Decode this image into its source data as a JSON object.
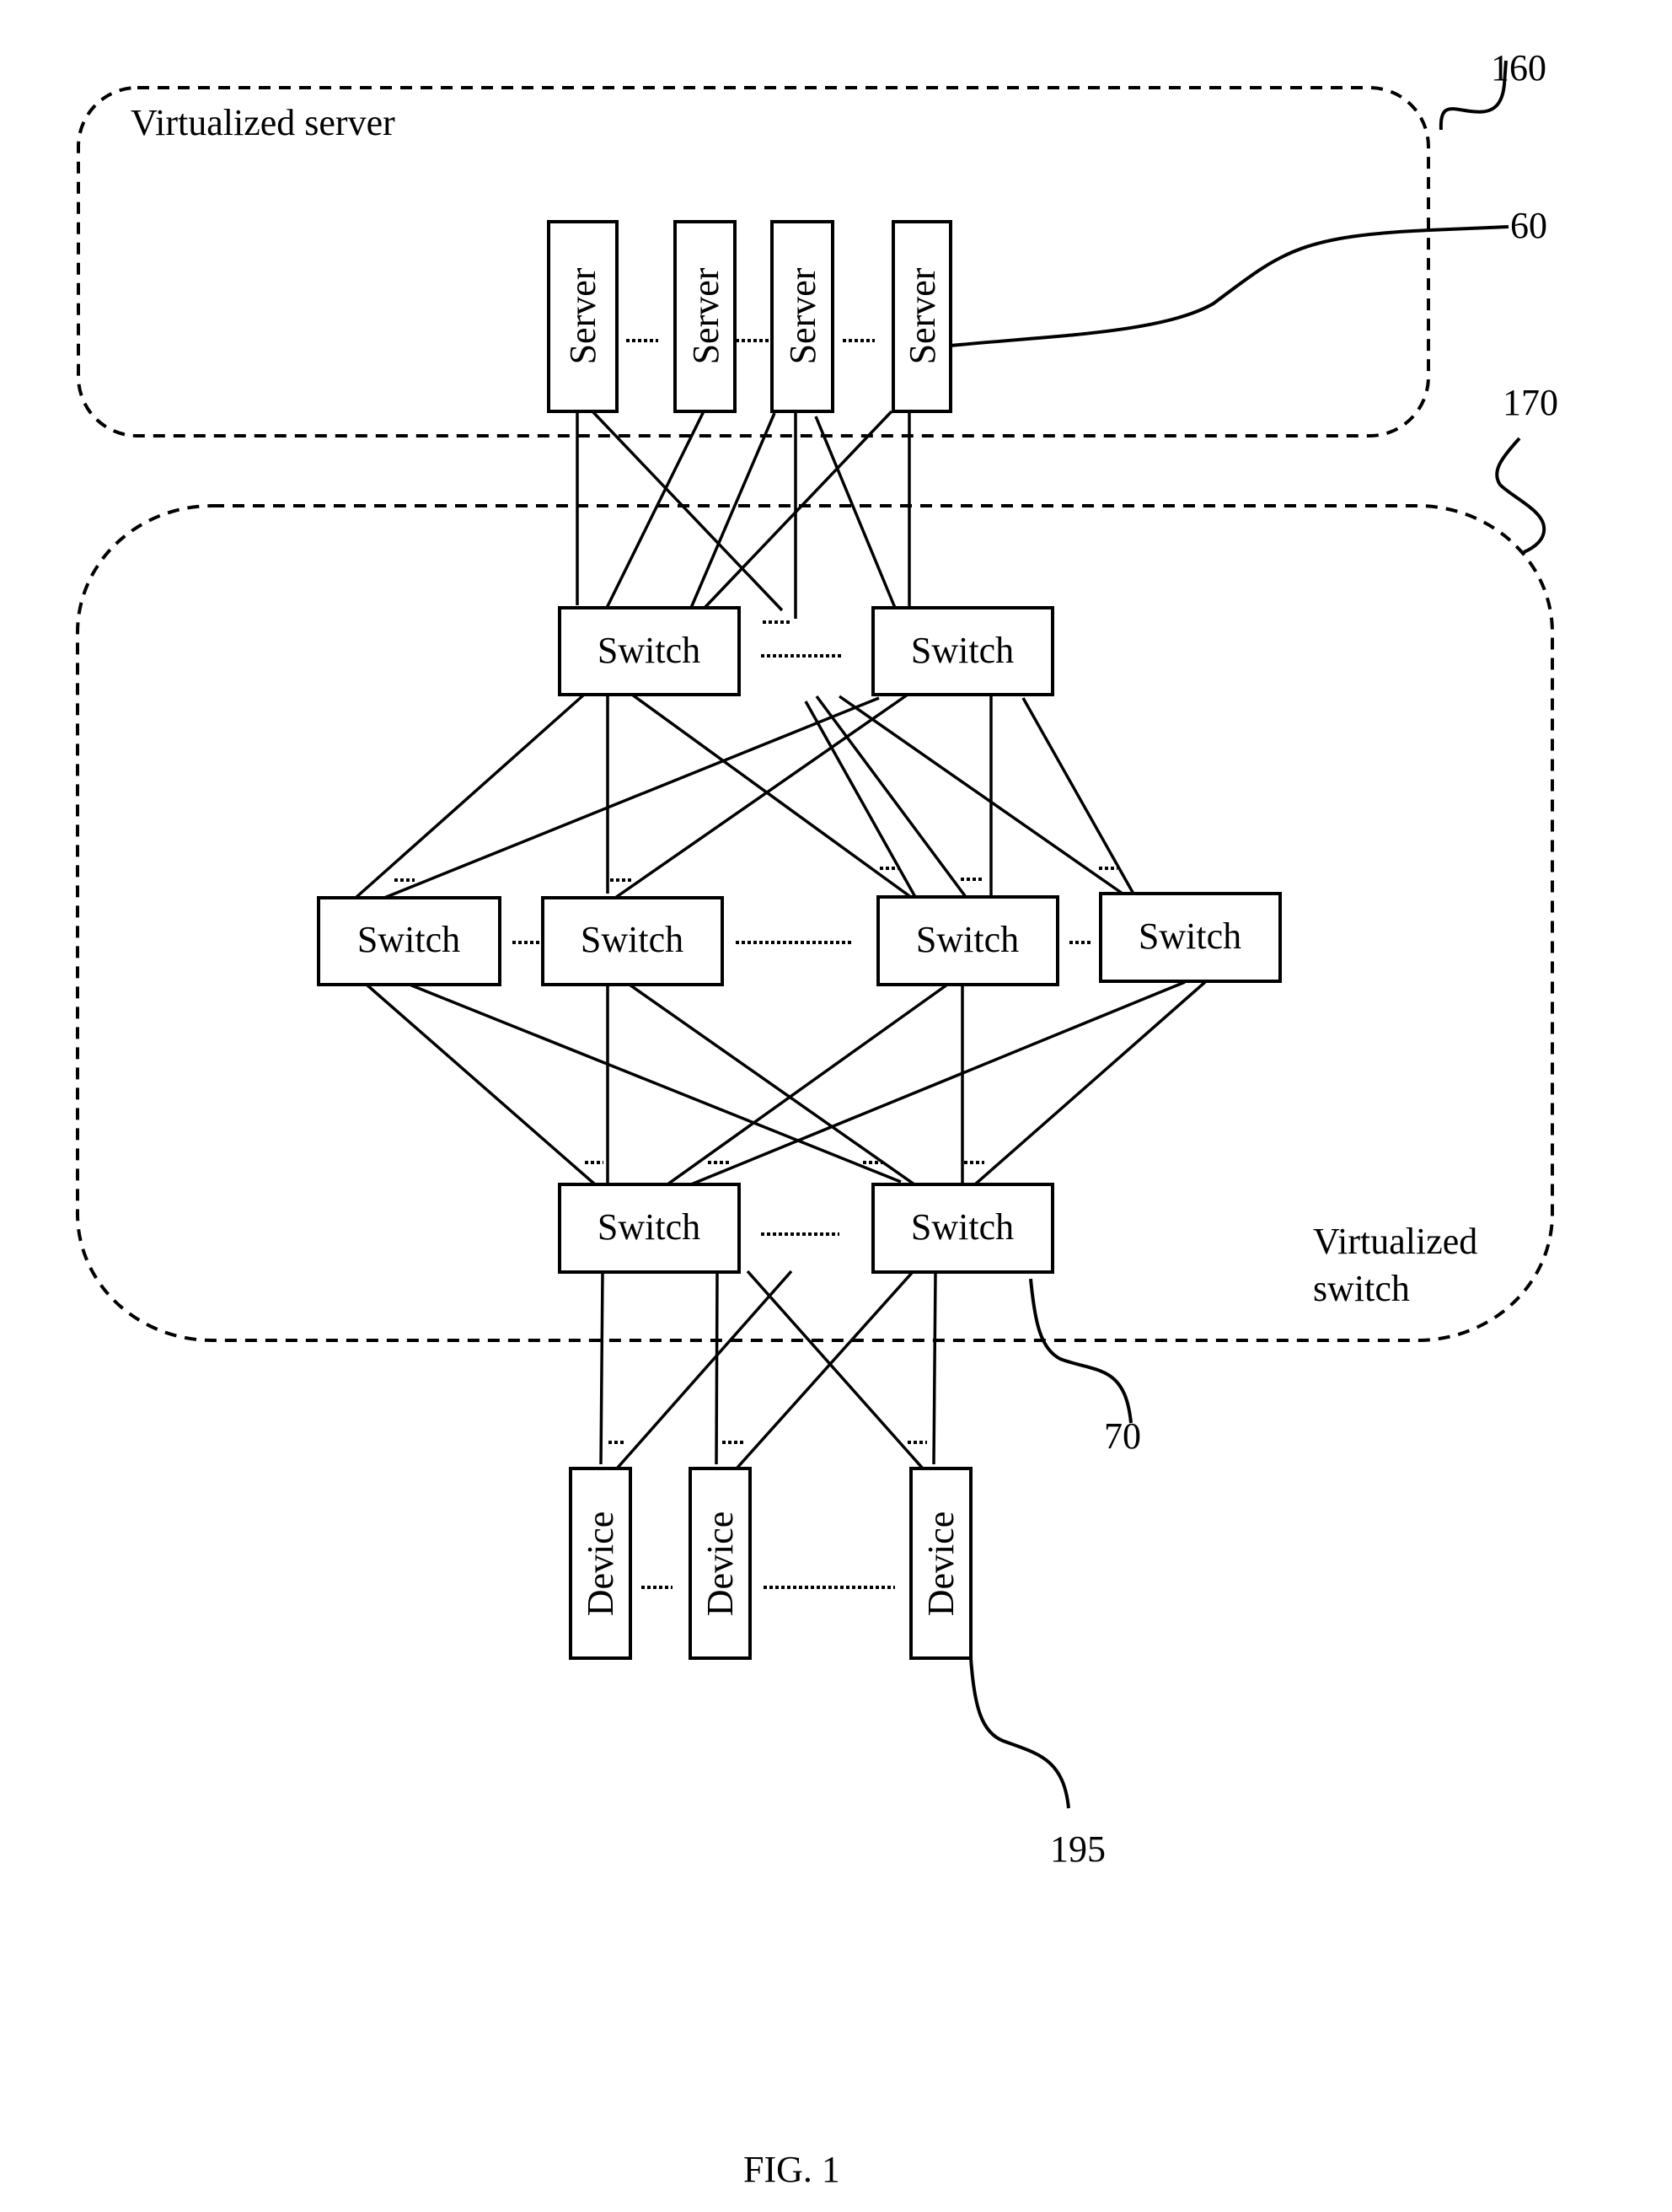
{
  "figure": {
    "caption": "FIG. 1",
    "ref_labels": {
      "virtualized_server_group": "160",
      "server": "60",
      "virtualized_switch_group": "170",
      "switch": "70",
      "device": "195"
    }
  },
  "groups": {
    "virtualized_server": {
      "title": "Virtualized server"
    },
    "virtualized_switch": {
      "title_line1": "Virtualized",
      "title_line2": "switch"
    }
  },
  "layers": {
    "servers": [
      {
        "label": "Server"
      },
      {
        "label": "Server"
      },
      {
        "label": "Server"
      },
      {
        "label": "Server"
      }
    ],
    "top_switches": [
      {
        "label": "Switch"
      },
      {
        "label": "Switch"
      }
    ],
    "middle_switches": [
      {
        "label": "Switch"
      },
      {
        "label": "Switch"
      },
      {
        "label": "Switch"
      },
      {
        "label": "Switch"
      }
    ],
    "bottom_switches": [
      {
        "label": "Switch"
      },
      {
        "label": "Switch"
      }
    ],
    "devices": [
      {
        "label": "Device"
      },
      {
        "label": "Device"
      },
      {
        "label": "Device"
      }
    ]
  },
  "colors": {
    "ink": "#000000",
    "background": "#ffffff"
  }
}
